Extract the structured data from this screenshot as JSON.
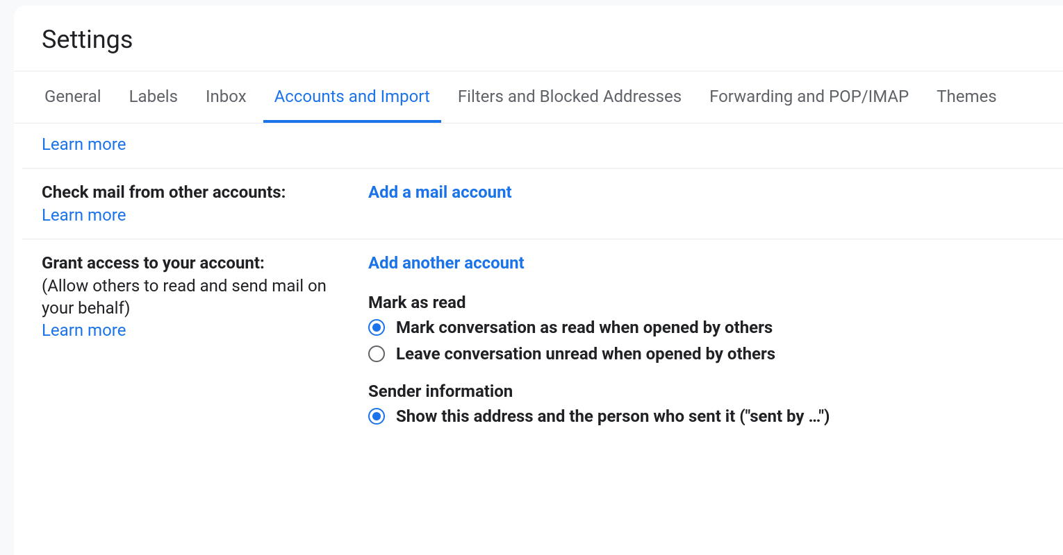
{
  "page": {
    "title": "Settings"
  },
  "tabs": [
    {
      "label": "General",
      "active": false
    },
    {
      "label": "Labels",
      "active": false
    },
    {
      "label": "Inbox",
      "active": false
    },
    {
      "label": "Accounts and Import",
      "active": true
    },
    {
      "label": "Filters and Blocked Addresses",
      "active": false
    },
    {
      "label": "Forwarding and POP/IMAP",
      "active": false
    },
    {
      "label": "Themes",
      "active": false
    }
  ],
  "orphan_learn_more": "Learn more",
  "check_mail": {
    "label": "Check mail from other accounts:",
    "learn_more": "Learn more",
    "action": "Add a mail account"
  },
  "grant_access": {
    "label": "Grant access to your account:",
    "sublabel": "(Allow others to read and send mail on your behalf)",
    "learn_more": "Learn more",
    "action": "Add another account",
    "mark_as_read": {
      "heading": "Mark as read",
      "options": [
        {
          "label": "Mark conversation as read when opened by others",
          "checked": true
        },
        {
          "label": "Leave conversation unread when opened by others",
          "checked": false
        }
      ]
    },
    "sender_info": {
      "heading": "Sender information",
      "options": [
        {
          "label": "Show this address and the person who sent it (\"sent by …\")",
          "checked": true
        }
      ]
    }
  }
}
